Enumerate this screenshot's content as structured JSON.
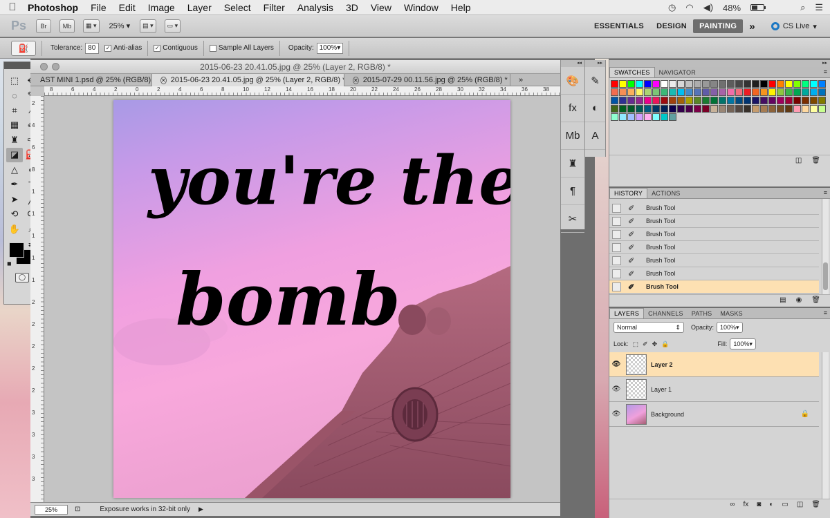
{
  "menubar": {
    "app_name": "Photoshop",
    "items": [
      "File",
      "Edit",
      "Image",
      "Layer",
      "Select",
      "Filter",
      "Analysis",
      "3D",
      "View",
      "Window",
      "Help"
    ],
    "battery": "48%"
  },
  "appbar": {
    "logo": "Ps",
    "bridge": "Br",
    "minibridge": "Mb",
    "zoom": "25%",
    "workspaces": [
      "ESSENTIALS",
      "DESIGN",
      "PAINTING"
    ],
    "active_workspace": "PAINTING",
    "more": "»",
    "cs_live": "CS Live"
  },
  "options": {
    "tolerance_label": "Tolerance:",
    "tolerance_value": "80",
    "antialias_label": "Anti-alias",
    "contiguous_label": "Contiguous",
    "sample_all_label": "Sample All Layers",
    "opacity_label": "Opacity:",
    "opacity_value": "100%"
  },
  "document": {
    "window_title": "2015-06-23 20.41.05.jpg @ 25% (Layer 2, RGB/8) *",
    "tabs": [
      {
        "label": "AST MINI 1.psd @ 25% (RGB/8) *",
        "active": false
      },
      {
        "label": "2015-06-23 20.41.05.jpg @ 25% (Layer 2, RGB/8) *",
        "active": true
      },
      {
        "label": "2015-07-29 00.11.56.jpg @ 25% (RGB/8) *",
        "active": false
      }
    ],
    "artwork_text_line1": "you're the",
    "artwork_text_line2": "bomb",
    "zoom_status": "25%",
    "status_text": "Exposure works in 32-bit only"
  },
  "ruler": {
    "top_labels": [
      "8",
      "6",
      "4",
      "2",
      "0",
      "2",
      "4",
      "6",
      "8",
      "10",
      "12",
      "14",
      "16",
      "18",
      "20",
      "22",
      "24",
      "26",
      "28",
      "30",
      "32",
      "34",
      "36",
      "38"
    ],
    "left_labels": [
      "2",
      "4",
      "6",
      "8",
      "1",
      "1",
      "1",
      "1",
      "1",
      "2",
      "2",
      "2",
      "2",
      "2",
      "3",
      "3",
      "3",
      "3"
    ]
  },
  "swatches_panel": {
    "tabs": [
      "SWATCHES",
      "NAVIGATOR"
    ],
    "colors": [
      "#ff0000",
      "#ffff00",
      "#00ff00",
      "#00ffff",
      "#0000ff",
      "#ff00ff",
      "#ffffff",
      "#ebebeb",
      "#d7d7d7",
      "#c2c2c2",
      "#adadad",
      "#999999",
      "#858585",
      "#707070",
      "#5c5c5c",
      "#474747",
      "#333333",
      "#1f1f1f",
      "#000000",
      "#ff0000",
      "#ff8000",
      "#ffff00",
      "#80ff00",
      "#00ff80",
      "#00ffff",
      "#0080ff",
      "#f26c4f",
      "#f68e55",
      "#fbaf5c",
      "#fff467",
      "#acd372",
      "#7cc576",
      "#3bb878",
      "#1abbb4",
      "#00bff3",
      "#438ccb",
      "#5574b9",
      "#605ca8",
      "#855fa8",
      "#a763a8",
      "#f06ea9",
      "#f26d7d",
      "#ed1c24",
      "#f26522",
      "#f7941d",
      "#fff200",
      "#8dc73f",
      "#39b54a",
      "#00a651",
      "#00a99d",
      "#00aeef",
      "#0072bc",
      "#0054a6",
      "#2e3192",
      "#662d91",
      "#92278f",
      "#ec008c",
      "#ed145b",
      "#9e0b0f",
      "#a0410d",
      "#a3620a",
      "#aba000",
      "#598527",
      "#1a7b30",
      "#007236",
      "#00746b",
      "#0076a3",
      "#004b80",
      "#003471",
      "#1b1464",
      "#440e62",
      "#630460",
      "#9e005d",
      "#9e0039",
      "#790000",
      "#7b2e00",
      "#7d4900",
      "#827b00",
      "#406618",
      "#005e20",
      "#005826",
      "#005952",
      "#005b7f",
      "#003663",
      "#002157",
      "#0d004c",
      "#32004b",
      "#4b0049",
      "#7b0046",
      "#7a0026",
      "#c7b299",
      "#998675",
      "#736357",
      "#534741",
      "#37302a",
      "#c69c6d",
      "#a67c52",
      "#8c6239",
      "#754c24",
      "#603913",
      "#ff9bb2",
      "#ffd9a0",
      "#ffffa0",
      "#c7ff90",
      "#90ffd0",
      "#90e8ff",
      "#a0c0ff",
      "#d0a0ff",
      "#ffb0f0",
      "#7fffff",
      "#00c8c8",
      "#60a0a0"
    ]
  },
  "history_panel": {
    "tabs": [
      "HISTORY",
      "ACTIONS"
    ],
    "rows": [
      "Brush Tool",
      "Brush Tool",
      "Brush Tool",
      "Brush Tool",
      "Brush Tool",
      "Brush Tool",
      "Brush Tool"
    ],
    "selected_index": 6
  },
  "layers_panel": {
    "tabs": [
      "LAYERS",
      "CHANNELS",
      "PATHS",
      "MASKS"
    ],
    "blend_mode": "Normal",
    "opacity_label": "Opacity:",
    "opacity_value": "100%",
    "lock_label": "Lock:",
    "fill_label": "Fill:",
    "fill_value": "100%",
    "layers": [
      {
        "name": "Layer 2",
        "selected": true
      },
      {
        "name": "Layer 1",
        "selected": false
      },
      {
        "name": "Background",
        "selected": false
      }
    ]
  }
}
